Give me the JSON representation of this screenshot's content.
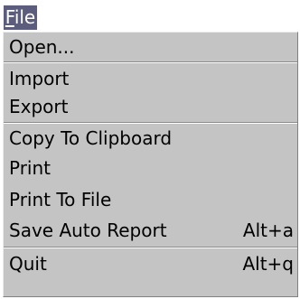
{
  "menubar": {
    "title_mnemonic": "F",
    "title_rest": "ile"
  },
  "menu": {
    "items": [
      {
        "label": "Open...",
        "shortcut": ""
      },
      {
        "label": "Import",
        "shortcut": ""
      },
      {
        "label": "Export",
        "shortcut": ""
      },
      {
        "label": "Copy To Clipboard",
        "shortcut": ""
      },
      {
        "label": "Print",
        "shortcut": ""
      },
      {
        "label": "Print To File",
        "shortcut": ""
      },
      {
        "label": "Save Auto Report",
        "shortcut": "Alt+a"
      },
      {
        "label": "Quit",
        "shortcut": "Alt+q"
      }
    ]
  },
  "colors": {
    "menubar_highlight": "#5c5c7c",
    "menu_background": "#c4c4c4"
  }
}
